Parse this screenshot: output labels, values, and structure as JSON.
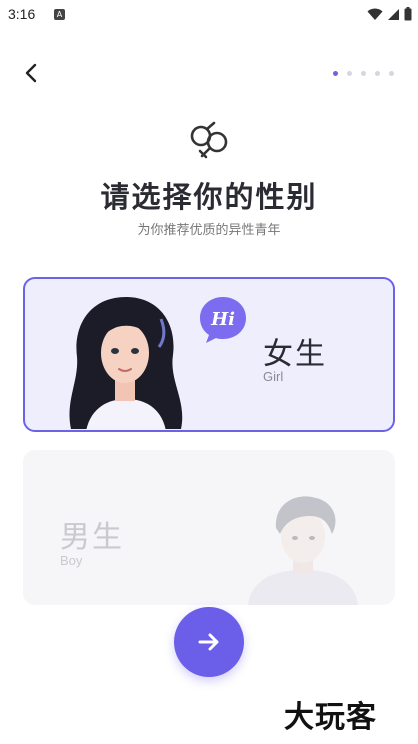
{
  "status_bar": {
    "time": "3:16",
    "app_icon_glyph": "A"
  },
  "header": {
    "back_icon": "chevron-left-icon",
    "progress": {
      "total_steps": 5,
      "current_step": 1
    }
  },
  "main": {
    "title": "请选择你的性别",
    "subtitle": "为你推荐优质的异性青年",
    "options": [
      {
        "label": "女生",
        "sub": "Girl",
        "bubble": "Hi",
        "selected": true
      },
      {
        "label": "男生",
        "sub": "Boy",
        "selected": false
      }
    ]
  },
  "next_button": {
    "icon": "arrow-right-icon"
  },
  "watermark": "大玩客",
  "colors": {
    "accent": "#6b5ee8",
    "selected_bg": "#efeefd",
    "unselected_bg": "#f6f6f8"
  }
}
